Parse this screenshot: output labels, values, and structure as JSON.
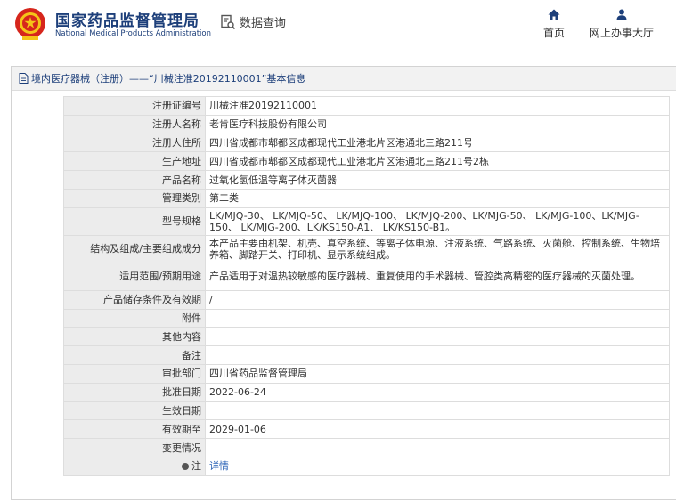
{
  "header": {
    "brand_cn": "国家药品监督管理局",
    "brand_en": "National Medical Products Administration",
    "data_query": "数据查询",
    "nav_home": "首页",
    "nav_hall": "网上办事大厅",
    "accent": "#1d3f7a"
  },
  "panel": {
    "title": "境内医疗器械（注册）——“川械注准20192110001”基本信息"
  },
  "rows": [
    {
      "label": "注册证编号",
      "value": "川械注准20192110001"
    },
    {
      "label": "注册人名称",
      "value": "老肯医疗科技股份有限公司"
    },
    {
      "label": "注册人住所",
      "value": "四川省成都市郫都区成都现代工业港北片区港通北三路211号"
    },
    {
      "label": "生产地址",
      "value": "四川省成都市郫都区成都现代工业港北片区港通北三路211号2栋"
    },
    {
      "label": "产品名称",
      "value": "过氧化氢低温等离子体灭菌器"
    },
    {
      "label": "管理类别",
      "value": "第二类"
    },
    {
      "label": "型号规格",
      "value": "LK/MJQ-30、 LK/MJQ-50、 LK/MJQ-100、 LK/MJQ-200、LK/MJG-50、 LK/MJG-100、LK/MJG-150、 LK/MJG-200、LK/KS150-A1、 LK/KS150-B1。"
    },
    {
      "label": "结构及组成/主要组成成分",
      "value": "本产品主要由机架、机壳、真空系统、等离子体电源、注液系统、气路系统、灭菌舱、控制系统、生物培养箱、脚踏开关、打印机、显示系统组成。"
    },
    {
      "label": "适用范围/预期用途",
      "value": "产品适用于对温热较敏感的医疗器械、重复使用的手术器械、管腔类高精密的医疗器械的灭菌处理。"
    },
    {
      "label": "产品储存条件及有效期",
      "value": "/"
    },
    {
      "label": "附件",
      "value": ""
    },
    {
      "label": "其他内容",
      "value": ""
    },
    {
      "label": "备注",
      "value": ""
    },
    {
      "label": "审批部门",
      "value": "四川省药品监督管理局"
    },
    {
      "label": "批准日期",
      "value": "2022-06-24"
    },
    {
      "label": "生效日期",
      "value": ""
    },
    {
      "label": "有效期至",
      "value": "2029-01-06"
    },
    {
      "label": "变更情况",
      "value": ""
    },
    {
      "label": "注",
      "value": "详情"
    }
  ]
}
